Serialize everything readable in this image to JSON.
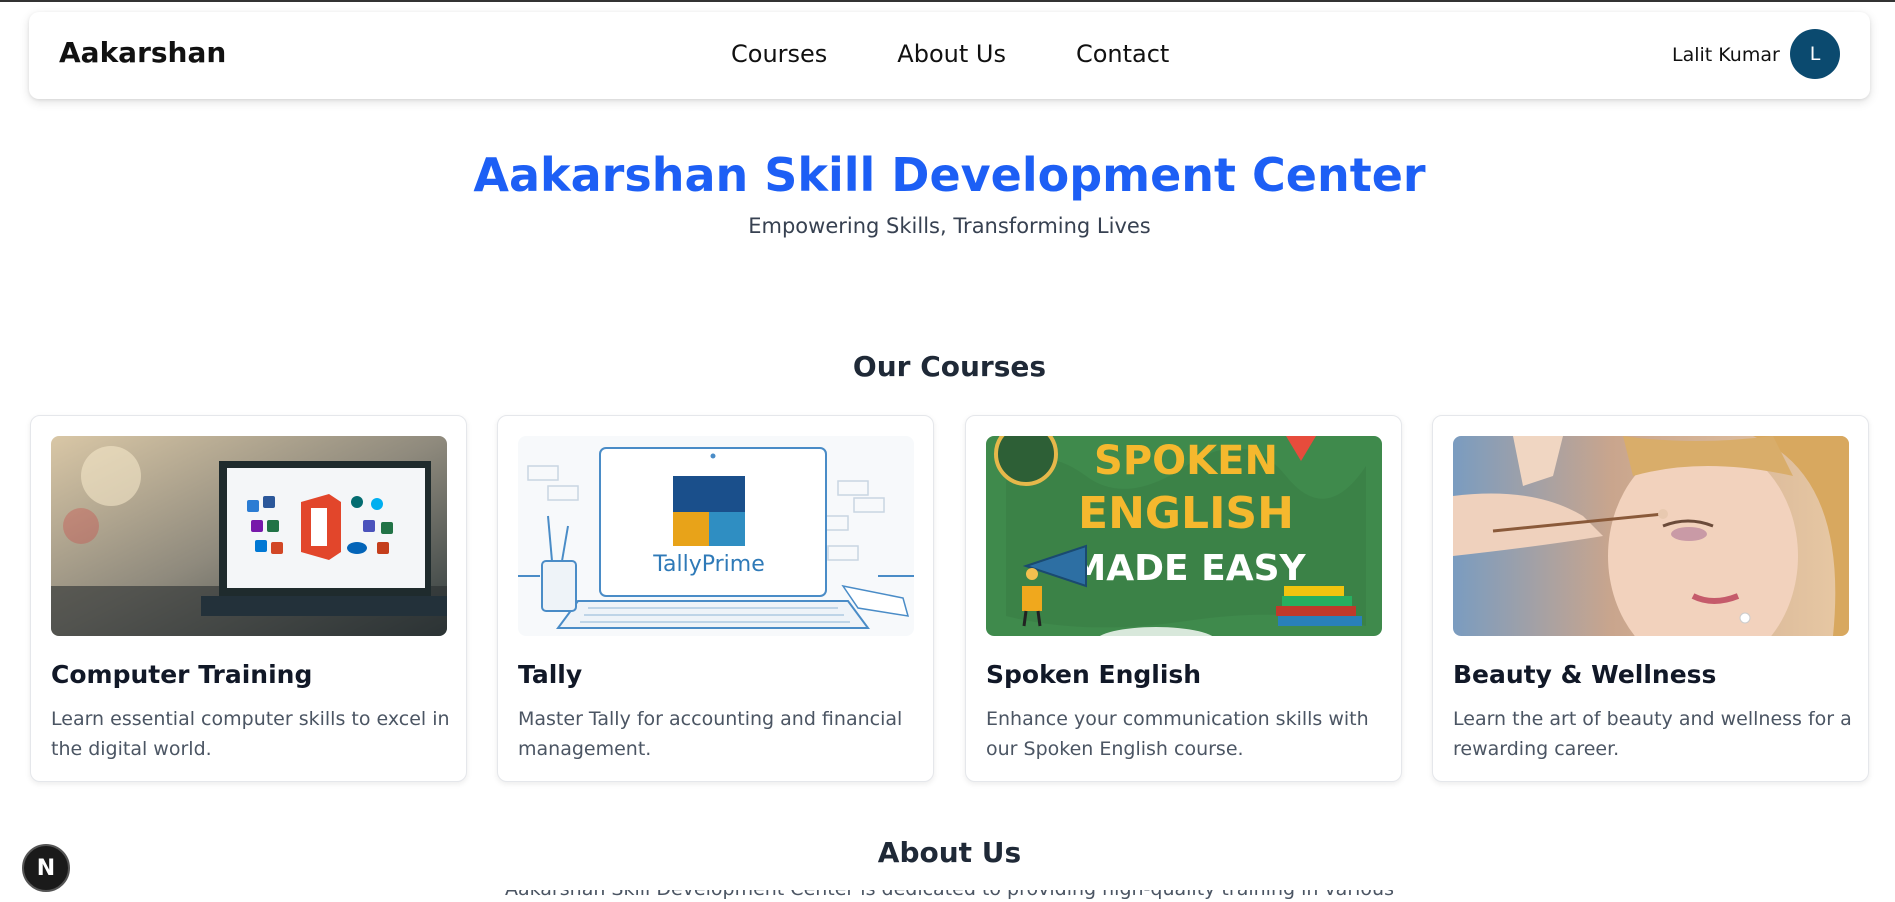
{
  "header": {
    "brand": "Aakarshan",
    "nav": [
      "Courses",
      "About Us",
      "Contact"
    ],
    "user_name": "Lalit Kumar",
    "avatar_initial": "L"
  },
  "hero": {
    "title": "Aakarshan Skill Development Center",
    "subtitle": "Empowering Skills, Transforming Lives"
  },
  "courses": {
    "heading": "Our Courses",
    "items": [
      {
        "title": "Computer Training",
        "description": "Learn essential computer skills to excel in the digital world.",
        "image": "laptop-office-apps"
      },
      {
        "title": "Tally",
        "description": "Master Tally for accounting and financial management.",
        "image": "tallyprime-laptop",
        "image_text": "TallyPrime"
      },
      {
        "title": "Spoken English",
        "description": "Enhance your communication skills with our Spoken English course.",
        "image": "spoken-english-poster",
        "image_text": [
          "SPOKEN",
          "ENGLISH",
          "MADE EASY"
        ]
      },
      {
        "title": "Beauty & Wellness",
        "description": "Learn the art of beauty and wellness for a rewarding career.",
        "image": "makeup-artist"
      }
    ]
  },
  "about": {
    "heading": "About Us",
    "intro_partial": "Aakarshan Skill Development Center is dedicated to providing high-quality training in various"
  },
  "dev_badge": "N",
  "colors": {
    "accent": "#1d5ff5",
    "avatar_bg": "#0b4a6f"
  }
}
